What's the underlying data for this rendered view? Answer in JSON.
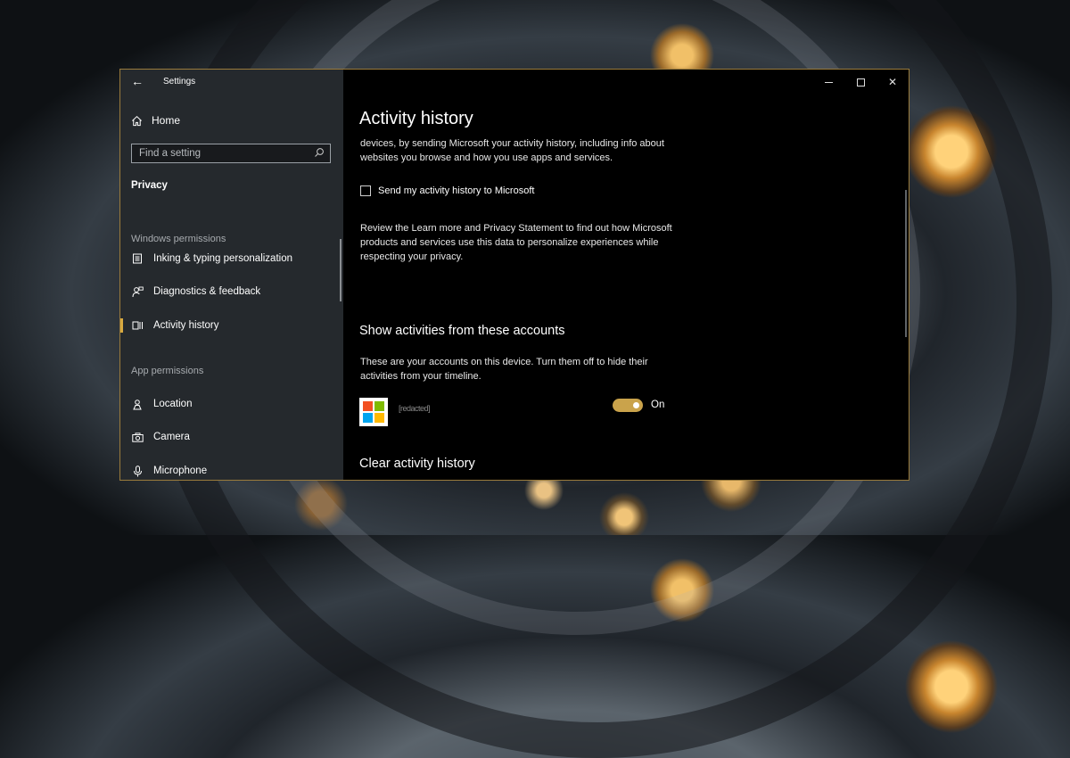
{
  "window": {
    "title": "Settings"
  },
  "sidebar": {
    "home_label": "Home",
    "search_placeholder": "Find a setting",
    "section": "Privacy",
    "groups": [
      {
        "label": "Windows permissions",
        "items": [
          {
            "label": "Inking & typing personalization",
            "icon": "notepad-icon"
          },
          {
            "label": "Diagnostics & feedback",
            "icon": "person-feedback-icon"
          },
          {
            "label": "Activity history",
            "icon": "timeline-icon",
            "selected": true
          }
        ]
      },
      {
        "label": "App permissions",
        "items": [
          {
            "label": "Location",
            "icon": "location-icon"
          },
          {
            "label": "Camera",
            "icon": "camera-icon"
          },
          {
            "label": "Microphone",
            "icon": "microphone-icon"
          }
        ]
      }
    ]
  },
  "content": {
    "title": "Activity history",
    "intro": "devices, by sending Microsoft your activity history, including info about websites you browse and how you use apps and services.",
    "checkbox_label": "Send my activity history to Microsoft",
    "checkbox_checked": false,
    "review_text": "Review the Learn more and Privacy Statement to find out how Microsoft products and services use this data to personalize experiences while respecting your privacy.",
    "accounts_heading": "Show activities from these accounts",
    "accounts_text": "These are your accounts on this device. Turn them off to hide their activities from your timeline.",
    "account": {
      "name": "[redacted]",
      "toggle_state": "On",
      "toggle_on": true
    },
    "clear_heading": "Clear activity history"
  },
  "colors": {
    "accent": "#caa34b",
    "selection_bar": "#d7a940",
    "window_border": "#9a7b3c",
    "ms_red": "#f25022",
    "ms_green": "#7fba00",
    "ms_blue": "#00a4ef",
    "ms_yellow": "#ffb900"
  }
}
